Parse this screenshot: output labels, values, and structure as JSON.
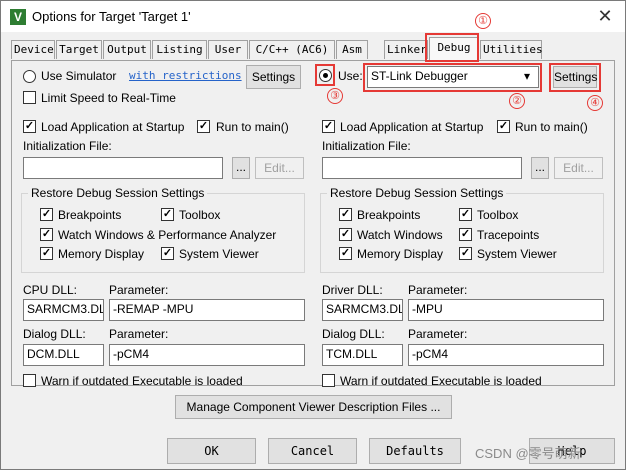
{
  "window": {
    "title": "Options for Target 'Target 1'",
    "icon_glyph": "V",
    "close_glyph": "✕"
  },
  "tabs": [
    "Device",
    "Target",
    "Output",
    "Listing",
    "User",
    "C/C++ (AC6)",
    "Asm",
    "Linker",
    "Debug",
    "Utilities"
  ],
  "active_tab": "Debug",
  "annotations": {
    "m1": "①",
    "m2": "②",
    "m3": "③",
    "m4": "④",
    "color": "#e53935"
  },
  "left": {
    "use_simulator_label": "Use Simulator",
    "with_restrictions_link": "with restrictions",
    "settings_button": "Settings",
    "limit_speed_label": "Limit Speed to Real-Time",
    "load_app_label": "Load Application at Startup",
    "run_to_main_label": "Run to main()",
    "init_file_label": "Initialization File:",
    "init_file_value": "",
    "browse_button": "...",
    "edit_button": "Edit...",
    "restore_group_title": "Restore Debug Session Settings",
    "restore_items": [
      "Breakpoints",
      "Toolbox",
      "Watch Windows & Performance Analyzer",
      "Memory Display",
      "System Viewer"
    ],
    "cpu_dll_label": "CPU DLL:",
    "cpu_param_label": "Parameter:",
    "cpu_dll_value": "SARMCM3.DLL",
    "cpu_param_value": "-REMAP -MPU",
    "dialog_dll_label": "Dialog DLL:",
    "dialog_param_label": "Parameter:",
    "dialog_dll_value": "DCM.DLL",
    "dialog_param_value": "-pCM4",
    "warn_label": "Warn if outdated Executable is loaded"
  },
  "right": {
    "use_label": "Use:",
    "debugger_value": "ST-Link Debugger",
    "settings_button": "Settings",
    "load_app_label": "Load Application at Startup",
    "run_to_main_label": "Run to main()",
    "init_file_label": "Initialization File:",
    "init_file_value": "",
    "browse_button": "...",
    "edit_button": "Edit...",
    "restore_group_title": "Restore Debug Session Settings",
    "restore_items": [
      "Breakpoints",
      "Toolbox",
      "Watch Windows",
      "Tracepoints",
      "Memory Display",
      "System Viewer"
    ],
    "driver_dll_label": "Driver DLL:",
    "driver_param_label": "Parameter:",
    "driver_dll_value": "SARMCM3.DLL",
    "driver_param_value": "-MPU",
    "dialog_dll_label": "Dialog DLL:",
    "dialog_param_label": "Parameter:",
    "dialog_dll_value": "TCM.DLL",
    "dialog_param_value": "-pCM4",
    "warn_label": "Warn if outdated Executable is loaded"
  },
  "manage_button": "Manage Component Viewer Description Files ...",
  "buttons": {
    "ok": "OK",
    "cancel": "Cancel",
    "defaults": "Defaults",
    "help": "Help"
  },
  "watermark": "CSDN @零号萌新",
  "check_glyph": "✓",
  "dropdown_glyph": "▾"
}
